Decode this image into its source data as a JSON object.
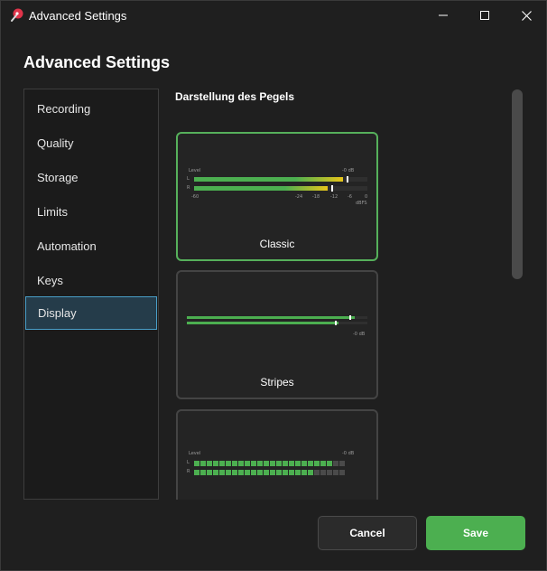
{
  "window": {
    "title": "Advanced Settings",
    "minimize_icon": "minimize-icon",
    "maximize_icon": "maximize-icon",
    "close_icon": "close-icon"
  },
  "page": {
    "title": "Advanced Settings"
  },
  "sidebar": {
    "items": [
      {
        "label": "Recording",
        "active": false
      },
      {
        "label": "Quality",
        "active": false
      },
      {
        "label": "Storage",
        "active": false
      },
      {
        "label": "Limits",
        "active": false
      },
      {
        "label": "Automation",
        "active": false
      },
      {
        "label": "Keys",
        "active": false
      },
      {
        "label": "Display",
        "active": true
      }
    ]
  },
  "display": {
    "section_label": "Darstellung des Pegels",
    "options": [
      {
        "label": "Classic",
        "selected": true,
        "preview": {
          "level_label": "Level",
          "db_label": "-0 dB",
          "channels": [
            "L",
            "R"
          ],
          "levels": [
            0.86,
            0.77
          ],
          "peaks": [
            0.88,
            0.79
          ],
          "scale": [
            "-60",
            "-24",
            "-18",
            "-12",
            "-6",
            "0"
          ],
          "unit": "dBFS"
        }
      },
      {
        "label": "Stripes",
        "selected": false,
        "preview": {
          "levels": [
            0.93,
            0.84
          ],
          "db_label": "-0 dB"
        }
      },
      {
        "label": "",
        "selected": false,
        "preview": {
          "level_label": "Level",
          "db_label": "-0 dB",
          "channels": [
            "L",
            "R"
          ],
          "segments_total": 24,
          "segments_lit": [
            22,
            19
          ]
        }
      }
    ]
  },
  "footer": {
    "cancel_label": "Cancel",
    "save_label": "Save"
  },
  "colors": {
    "accent_green": "#4caf50",
    "selection_blue": "#4a9fc8",
    "meter_yellow": "#e8c51a"
  }
}
